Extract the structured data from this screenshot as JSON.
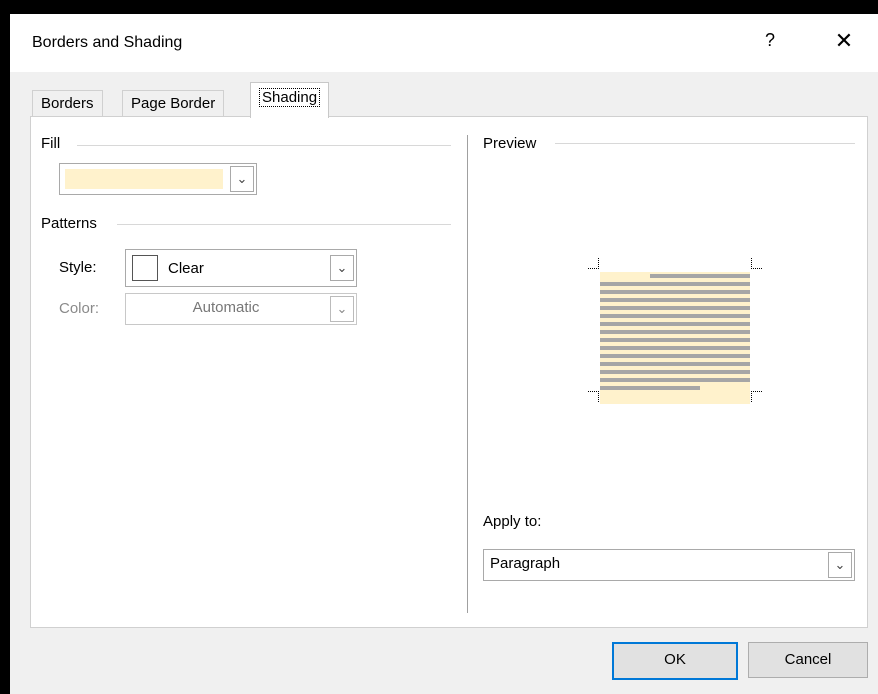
{
  "dialog": {
    "title": "Borders and Shading",
    "help_glyph": "?",
    "close_glyph": "✕"
  },
  "tabs": [
    {
      "label": "Borders",
      "active": false
    },
    {
      "label": "Page Border",
      "active": false
    },
    {
      "label": "Shading",
      "active": true
    }
  ],
  "fill": {
    "label": "Fill",
    "color": "#fff2cc"
  },
  "patterns": {
    "label": "Patterns",
    "style_label": "Style:",
    "style_value": "Clear",
    "color_label": "Color:",
    "color_value": "Automatic"
  },
  "preview": {
    "label": "Preview",
    "shade_color": "#fff2cc",
    "line_color": "#a6a6a6"
  },
  "apply_to": {
    "label": "Apply to:",
    "value": "Paragraph"
  },
  "buttons": {
    "ok": "OK",
    "cancel": "Cancel"
  },
  "icons": {
    "dropdown": "chevron-down-icon",
    "help": "help-icon",
    "close": "close-icon"
  }
}
